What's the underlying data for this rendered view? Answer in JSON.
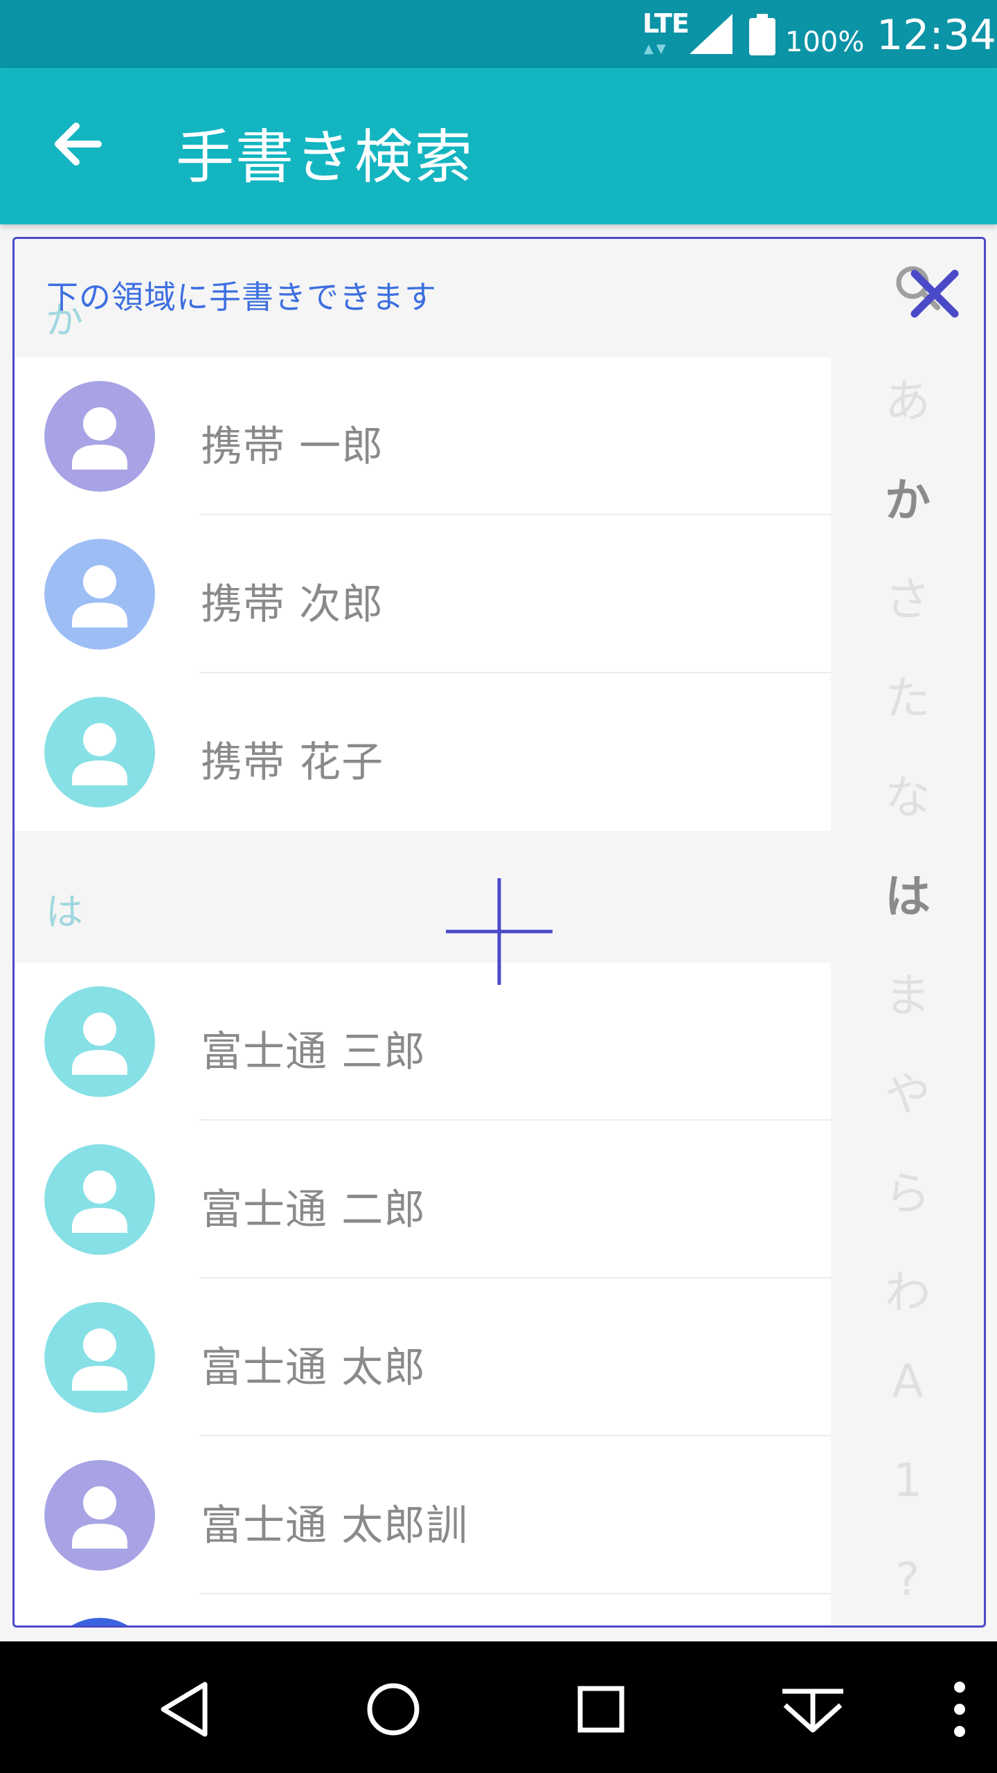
{
  "status_bar": {
    "network": "LTE",
    "battery_pct": "100%",
    "clock": "12:34"
  },
  "app_bar": {
    "title": "手書き検索"
  },
  "handwriting_panel": {
    "hint": "下の領域に手書きできます",
    "accent_color": "#4a4ac8"
  },
  "sections": [
    {
      "letter": "か",
      "contacts": [
        {
          "name": "携帯 一郎",
          "avatar_color": "#a7a3e4"
        },
        {
          "name": "携帯 次郎",
          "avatar_color": "#9dbdf5"
        },
        {
          "name": "携帯 花子",
          "avatar_color": "#86e0e6"
        }
      ]
    },
    {
      "letter": "は",
      "contacts": [
        {
          "name": "富士通 三郎",
          "avatar_color": "#86e0e6"
        },
        {
          "name": "富士通 二郎",
          "avatar_color": "#86e0e6"
        },
        {
          "name": "富士通 太郎",
          "avatar_color": "#86e0e6"
        },
        {
          "name": "富士通 太郎訓",
          "avatar_color": "#a7a3e4"
        }
      ]
    }
  ],
  "index_bar": {
    "items": [
      "あ",
      "か",
      "さ",
      "た",
      "な",
      "は",
      "ま",
      "や",
      "ら",
      "わ",
      "A",
      "1",
      "?"
    ],
    "active": [
      "か",
      "は"
    ]
  },
  "nav_bar": {
    "icons": [
      "back-icon",
      "home-icon",
      "recents-icon",
      "hide-keyboard-icon",
      "overflow-icon"
    ]
  }
}
